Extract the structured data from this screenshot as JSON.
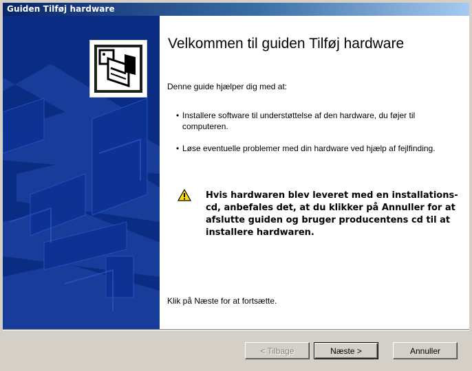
{
  "window": {
    "title": "Guiden Tilføj hardware"
  },
  "banner": {
    "icon": "hardware-install-icon",
    "colors": {
      "background": "#0b2c83",
      "shapes": "#1e47b8"
    }
  },
  "main": {
    "heading": "Velkommen til guiden Tilføj hardware",
    "intro": "Denne guide hjælper dig med at:",
    "bullets": [
      "Installere software til understøttelse af den hardware, du føjer til computeren.",
      "Løse eventuelle problemer med din hardware ved hjælp af fejlfinding."
    ],
    "warning_icon": "warning-icon",
    "warning": "Hvis hardwaren blev leveret med en installations-cd, anbefales det, at du klikker på Annuller for at afslutte guiden og bruger producentens cd til at installere hardwaren.",
    "footer": "Klik på Næste for at fortsætte."
  },
  "buttons": {
    "back": "< Tilbage",
    "next": "Næste >",
    "cancel": "Annuller"
  },
  "colors": {
    "titlebar_start": "#0a246a",
    "titlebar_end": "#a6caf0",
    "dialog_face": "#d4d0c8"
  }
}
